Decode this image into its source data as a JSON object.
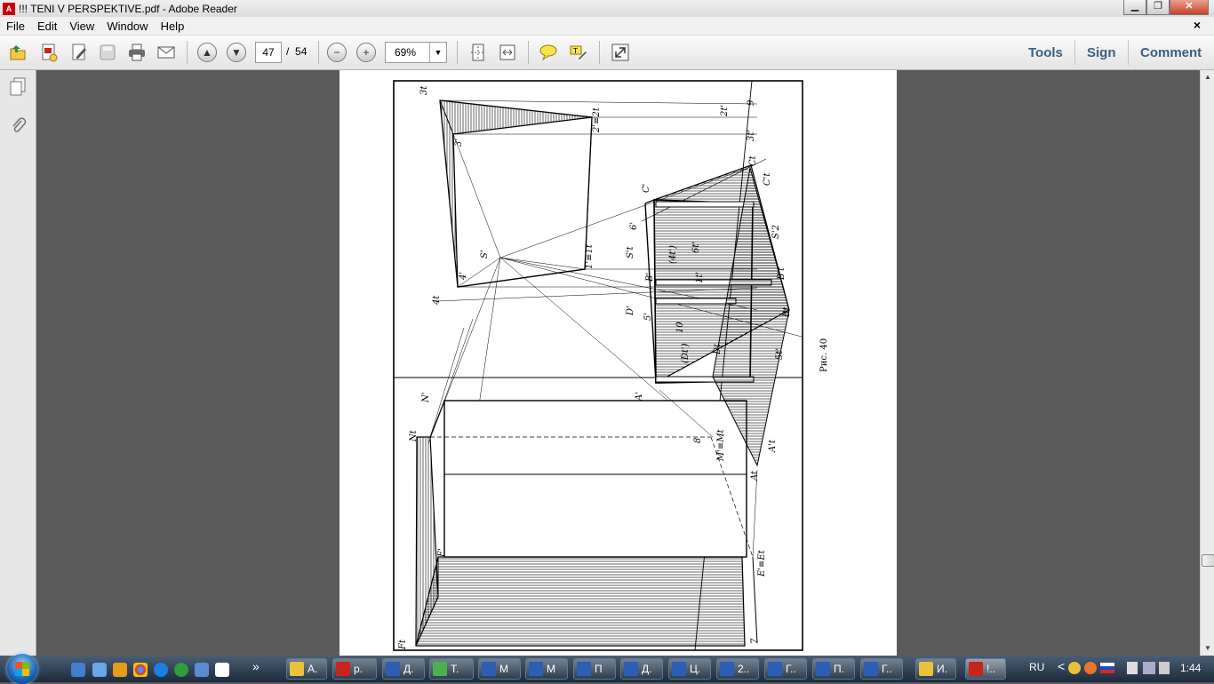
{
  "window": {
    "title": "!!! TENI V PERSPEKTIVE.pdf - Adobe Reader",
    "minimize": "▁",
    "restore": "❐",
    "close": "✕"
  },
  "menu": {
    "items": [
      "File",
      "Edit",
      "View",
      "Window",
      "Help"
    ],
    "doc_close": "×"
  },
  "toolbar": {
    "page_current": "47",
    "page_separator": "/",
    "page_total": "54",
    "zoom": "69%",
    "tools": "Tools",
    "sign": "Sign",
    "comment": "Comment",
    "icons": [
      "open-file-icon",
      "create-pdf-icon",
      "edit-icon",
      "save-icon",
      "print-icon",
      "email-icon",
      "page-up-icon",
      "page-down-icon",
      "zoom-out-icon",
      "zoom-in-icon",
      "fit-page-icon",
      "fit-width-icon",
      "comment-icon",
      "highlight-icon",
      "read-mode-icon"
    ]
  },
  "document": {
    "caption": "Рис. 40",
    "labels": [
      "3t",
      "2'≡2t",
      "3'",
      "2t'",
      "9",
      "3t'",
      "Ct",
      "C't",
      "C'",
      "6'",
      "S't",
      "(4t')",
      "S'",
      "6t'",
      "S'2",
      "1'≡1t",
      "4'",
      "B'",
      "1t'",
      "B't",
      "4t",
      "D'",
      "5'",
      "(Dt')",
      "10",
      "Dt",
      "Bt",
      "5t'",
      "A'",
      "N'",
      "8",
      "Nt",
      "M'≡Mt",
      "A't",
      "At",
      "F'",
      "E'≡Et",
      "Ft",
      "7"
    ]
  },
  "taskbar": {
    "tasks": [
      {
        "label": "А.",
        "color": "#e8c23a"
      },
      {
        "label": "р.",
        "color": "#c9241b"
      },
      {
        "label": "Д.",
        "color": "#2b5fb4"
      },
      {
        "label": "Т.",
        "color": "#4caf50"
      },
      {
        "label": "М",
        "color": "#2b5fb4"
      },
      {
        "label": "М",
        "color": "#2b5fb4"
      },
      {
        "label": "П",
        "color": "#2b5fb4"
      },
      {
        "label": "Д.",
        "color": "#2b5fb4"
      },
      {
        "label": "Ц.",
        "color": "#2b5fb4"
      },
      {
        "label": "2..",
        "color": "#2b5fb4"
      },
      {
        "label": "Г..",
        "color": "#2b5fb4"
      },
      {
        "label": "П.",
        "color": "#2b5fb4"
      },
      {
        "label": "Г..",
        "color": "#2b5fb4"
      },
      {
        "label": "И.",
        "color": "#e8c23a"
      },
      {
        "label": "!..",
        "color": "#c9241b"
      }
    ],
    "lang": "RU",
    "time": "1:44",
    "overflow": "»",
    "tray_chevron": "<"
  }
}
